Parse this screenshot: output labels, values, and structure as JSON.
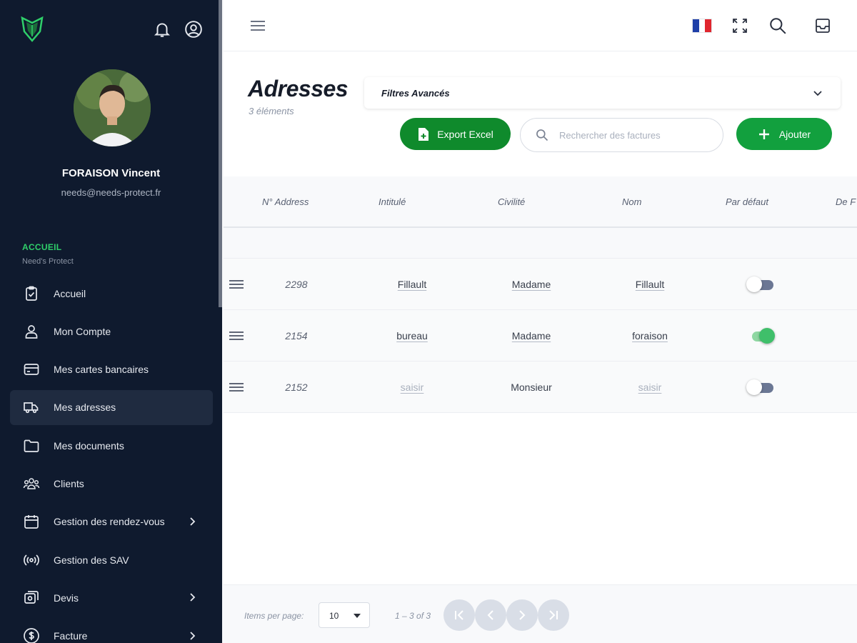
{
  "sidebar": {
    "user": {
      "name": "FORAISON Vincent",
      "email": "needs@needs-protect.fr"
    },
    "section": {
      "title": "ACCUEIL",
      "subtitle": "Need's Protect"
    },
    "items": [
      {
        "label": "Accueil",
        "icon": "clipboard-check-icon"
      },
      {
        "label": "Mon Compte",
        "icon": "user-icon"
      },
      {
        "label": "Mes cartes bancaires",
        "icon": "credit-card-icon"
      },
      {
        "label": "Mes adresses",
        "icon": "truck-icon",
        "active": true
      },
      {
        "label": "Mes documents",
        "icon": "folder-icon"
      },
      {
        "label": "Clients",
        "icon": "users-group-icon"
      },
      {
        "label": "Gestion des rendez-vous",
        "icon": "calendar-icon",
        "has_children": true
      },
      {
        "label": "Gestion des SAV",
        "icon": "broadcast-icon"
      },
      {
        "label": "Devis",
        "icon": "documents-icon",
        "has_children": true
      },
      {
        "label": "Facture",
        "icon": "dollar-icon",
        "has_children": true
      }
    ]
  },
  "colors": {
    "sidebar_bg": "#0f1a2e",
    "accent_green": "#12a03e",
    "export_green": "#0f8a2c",
    "section_green": "#2fcf6a"
  },
  "header": {
    "title": "Adresses",
    "count": "3 éléments",
    "filters_label": "Filtres Avancés"
  },
  "toolbar": {
    "export_label": "Export Excel",
    "search_placeholder": "Rechercher des factures",
    "add_label": "Ajouter"
  },
  "table": {
    "columns": [
      "N° Address",
      "Intitulé",
      "Civilité",
      "Nom",
      "Par défaut",
      "De F"
    ],
    "rows": [
      {
        "number": "2298",
        "title": "Fillault",
        "civility": "Madame",
        "name": "Fillault",
        "default": false
      },
      {
        "number": "2154",
        "title": "bureau",
        "civility": "Madame",
        "name": "foraison",
        "default": true
      },
      {
        "number": "2152",
        "title": "saisir",
        "civility": "Monsieur",
        "name": "saisir",
        "default": false
      }
    ]
  },
  "pagination": {
    "items_per_page_label": "Items per page:",
    "items_per_page": "10",
    "range": "1 – 3 of 3"
  }
}
